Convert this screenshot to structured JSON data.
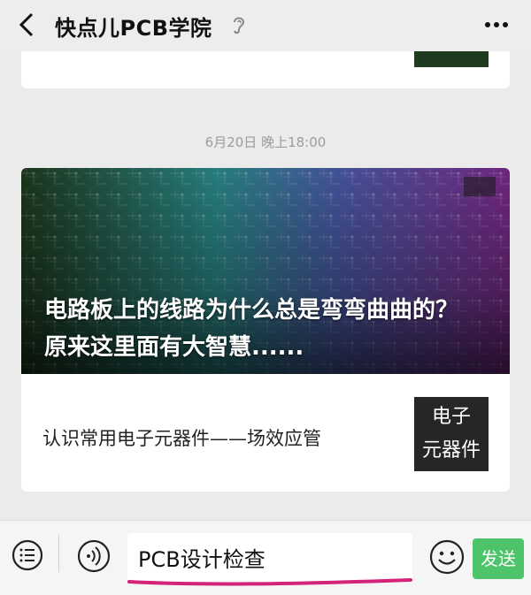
{
  "header": {
    "title": "快点儿PCB学院",
    "back_icon": "chevron-left-icon",
    "ear_icon": "ear-icon",
    "more_icon": "more-dots-icon"
  },
  "feed": {
    "timestamp": "6月20日 晚上18:00",
    "main_article": {
      "title_line1": "电路板上的线路为什么总是弯弯曲曲的？",
      "title_line2": "原来这里面有大智慧......"
    },
    "sub_article": {
      "title": "认识常用电子元器件——场效应管",
      "thumb_line1": "电子",
      "thumb_line2": "元器件"
    }
  },
  "bottombar": {
    "menu_icon": "menu-list-icon",
    "voice_icon": "voice-icon",
    "input_value": "PCB设计检查",
    "emoji_icon": "emoji-icon",
    "send_label": "发送"
  },
  "colors": {
    "send_button": "#4ec46a",
    "underline": "#d4237a"
  }
}
